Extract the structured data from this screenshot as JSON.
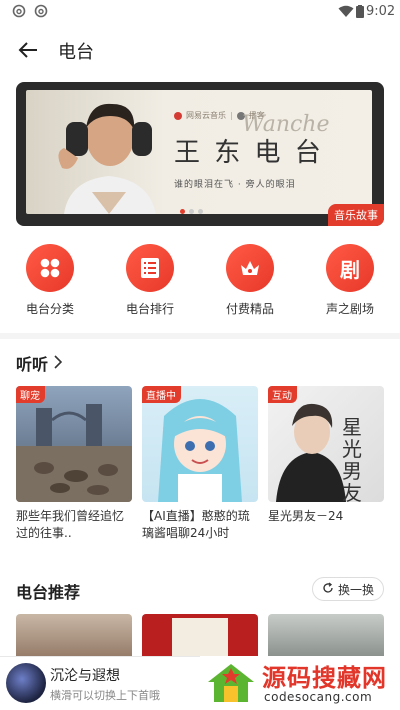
{
  "status": {
    "time": "9:02"
  },
  "header": {
    "title": "电台"
  },
  "banner": {
    "brand": "网易云音乐",
    "partner": "播客",
    "title": "王 东 电 台",
    "script": "Wanche",
    "subtitle": "谁的眼泪在飞 · 旁人的眼泪",
    "tag": "音乐故事",
    "dots": 3,
    "active_dot": 0
  },
  "categories": [
    {
      "label": "电台分类",
      "icon": "grid-icon"
    },
    {
      "label": "电台排行",
      "icon": "list-icon"
    },
    {
      "label": "付费精品",
      "icon": "crown-icon"
    },
    {
      "label": "声之剧场",
      "icon": "drama-icon"
    }
  ],
  "listen": {
    "title": "听听",
    "cards": [
      {
        "tag": "聊宠",
        "title": "那些年我们曾经追忆过的往事.."
      },
      {
        "tag": "直播中",
        "title": "【AI直播】憨憨的琉璃酱唱聊24小时"
      },
      {
        "tag": "互动",
        "title": "星光男友－24",
        "cover_text": "星光男友"
      }
    ]
  },
  "recommend": {
    "title": "电台推荐",
    "refresh_label": "换一换"
  },
  "player": {
    "title": "沉沦与遐想",
    "subtitle": "横滑可以切换上下首哦"
  },
  "watermark": {
    "site": "源码搜藏网",
    "url": "codesocang.com"
  },
  "colors": {
    "accent": "#e23c2c",
    "tag": "#e23c2c"
  }
}
